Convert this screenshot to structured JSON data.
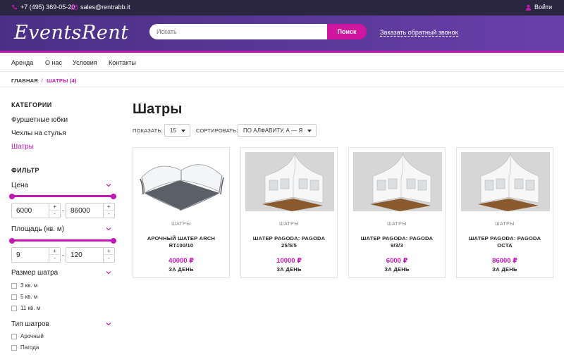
{
  "topbar": {
    "phone": "+7 (495) 369-05-20",
    "email": "sales@rentrabb.it",
    "login": "Войти"
  },
  "header": {
    "logo": "EventsRent",
    "search_placeholder": "Искать",
    "search_button": "Поиск",
    "callback": "Заказать обратный звонок"
  },
  "nav": [
    "Аренда",
    "О нас",
    "Условия",
    "Контакты"
  ],
  "breadcrumb": {
    "home": "ГЛАВНАЯ",
    "separator": "/",
    "current": "ШАТРЫ (4)"
  },
  "sidebar": {
    "categories_title": "КАТЕГОРИИ",
    "categories": [
      "Фуршетные юбки",
      "Чехлы на стулья",
      "Шатры"
    ],
    "filter_title": "ФИЛЬТР",
    "price": {
      "label": "Цена",
      "min": "6000",
      "max": "86000"
    },
    "area": {
      "label": "Площадь (кв. м)",
      "min": "9",
      "max": "120"
    },
    "spin_plus": "+",
    "spin_minus": "-",
    "dash": "-",
    "size": {
      "label": "Размер шатра",
      "options": [
        "3 кв. м",
        "5 кв. м",
        "11 кв. м"
      ]
    },
    "type": {
      "label": "Тип шатров",
      "options": [
        "Арочный",
        "Пагода"
      ]
    }
  },
  "main": {
    "title": "Шатры",
    "show_label": "ПОКАЗАТЬ:",
    "show_value": "15",
    "sort_label": "СОРТИРОВАТЬ:",
    "sort_value": "ПО АЛФАВИТУ, А — Я"
  },
  "products": [
    {
      "category": "ШАТРЫ",
      "name": "АРОЧНЫЙ ШАТЕР ARCH RT100/10",
      "price": "40000 ₽",
      "per": "ЗА ДЕНЬ",
      "image": "arch-tent-icon"
    },
    {
      "category": "ШАТРЫ",
      "name": "ШАТЕР PAGODA: PAGODA 25/5/5",
      "price": "10000 ₽",
      "per": "ЗА ДЕНЬ",
      "image": "pagoda-tent-icon"
    },
    {
      "category": "ШАТРЫ",
      "name": "ШАТЕР PAGODA: PAGODA 9/3/3",
      "price": "6000 ₽",
      "per": "ЗА ДЕНЬ",
      "image": "pagoda-tent-icon"
    },
    {
      "category": "ШАТРЫ",
      "name": "ШАТЕР PAGODA: PAGODA OCTA",
      "price": "86000 ₽",
      "per": "ЗА ДЕНЬ",
      "image": "pagoda-tent-icon"
    }
  ],
  "colors": {
    "accent": "#c318b5",
    "header": "#4b2f86",
    "topbar": "#2a2540"
  }
}
